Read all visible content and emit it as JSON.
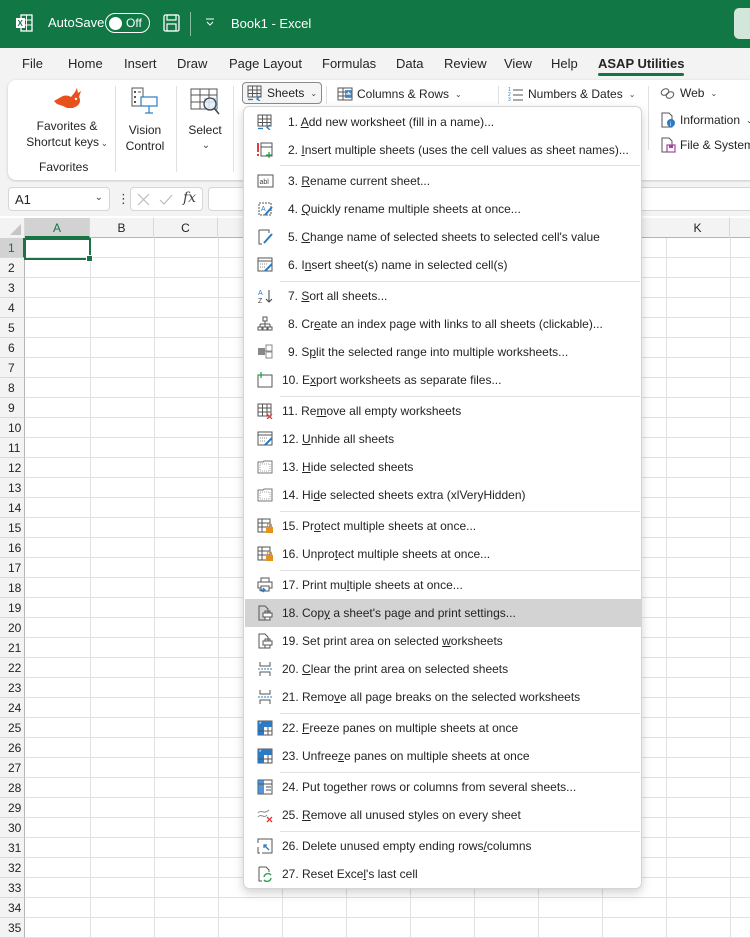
{
  "titlebar": {
    "autosave_label": "AutoSave",
    "autosave_state": "Off",
    "title": "Book1  -  Excel"
  },
  "menu_tabs": [
    {
      "label": "File"
    },
    {
      "label": "Home"
    },
    {
      "label": "Insert"
    },
    {
      "label": "Draw"
    },
    {
      "label": "Page Layout"
    },
    {
      "label": "Formulas"
    },
    {
      "label": "Data"
    },
    {
      "label": "Review"
    },
    {
      "label": "View"
    },
    {
      "label": "Help"
    },
    {
      "label": "ASAP Utilities",
      "active": true
    }
  ],
  "ribbon": {
    "favorites_line1": "Favorites &",
    "favorites_line2": "Shortcut keys",
    "favorites_group": "Favorites",
    "vision_line1": "Vision",
    "vision_line2": "Control",
    "select_label": "Select",
    "sheets_label": "Sheets",
    "columns_rows_label": "Columns & Rows",
    "numbers_dates_label": "Numbers & Dates",
    "web_label": "Web",
    "information_label": "Information",
    "file_system_label": "File & System"
  },
  "formula_bar": {
    "name_box": "A1",
    "fx_label": "fx",
    "value": ""
  },
  "grid": {
    "columns": [
      "A",
      "B",
      "C",
      "K"
    ],
    "rows": [
      "1",
      "2",
      "3",
      "4",
      "5",
      "6",
      "7",
      "8",
      "9",
      "10",
      "11",
      "12",
      "13",
      "14",
      "15",
      "16",
      "17",
      "18",
      "19",
      "20",
      "21",
      "22",
      "23",
      "24",
      "25",
      "26",
      "27",
      "28",
      "29",
      "30",
      "31",
      "32",
      "33",
      "34",
      "35"
    ],
    "active_cell": "A1"
  },
  "sheets_menu": {
    "items": [
      {
        "num": "1.",
        "pre": "",
        "u": "A",
        "post": "dd new worksheet (fill in a name)...",
        "icon": "add-worksheet-icon"
      },
      {
        "num": "2.",
        "pre": "",
        "u": "I",
        "post": "nsert multiple sheets (uses the cell values as sheet names)...",
        "icon": "insert-multiple-sheets-icon"
      },
      {
        "num": "3.",
        "pre": "",
        "u": "R",
        "post": "ename current sheet...",
        "icon": "rename-sheet-icon"
      },
      {
        "num": "4.",
        "pre": "",
        "u": "Q",
        "post": "uickly rename multiple sheets at once...",
        "icon": "quick-rename-icon"
      },
      {
        "num": "5.",
        "pre": "",
        "u": "C",
        "post": "hange name of selected sheets to selected cell's value",
        "icon": "change-name-icon"
      },
      {
        "num": "6.",
        "pre": "I",
        "u": "n",
        "post": "sert sheet(s) name in selected cell(s)",
        "icon": "insert-sheet-name-icon"
      },
      {
        "num": "7.",
        "pre": "",
        "u": "S",
        "post": "ort all sheets...",
        "icon": "sort-az-icon"
      },
      {
        "num": "8.",
        "pre": "Cr",
        "u": "e",
        "post": "ate an index page with links to all sheets (clickable)...",
        "icon": "index-tree-icon"
      },
      {
        "num": "9.",
        "pre": "S",
        "u": "p",
        "post": "lit the selected range into multiple worksheets...",
        "icon": "split-range-icon"
      },
      {
        "num": "10.",
        "pre": "E",
        "u": "x",
        "post": "port worksheets as separate files...",
        "icon": "export-sheets-icon"
      },
      {
        "num": "11.",
        "pre": "Re",
        "u": "m",
        "post": "ove all empty worksheets",
        "icon": "remove-empty-sheets-icon"
      },
      {
        "num": "12.",
        "pre": "",
        "u": "U",
        "post": "nhide all sheets",
        "icon": "unhide-sheets-icon"
      },
      {
        "num": "13.",
        "pre": "",
        "u": "H",
        "post": "ide selected sheets",
        "icon": "hide-sheets-icon"
      },
      {
        "num": "14.",
        "pre": "Hi",
        "u": "d",
        "post": "e selected sheets extra (xlVeryHidden)",
        "icon": "hide-sheets-extra-icon"
      },
      {
        "num": "15.",
        "pre": "Pr",
        "u": "o",
        "post": "tect multiple sheets at once...",
        "icon": "protect-sheets-icon"
      },
      {
        "num": "16.",
        "pre": "Unpro",
        "u": "t",
        "post": "ect multiple sheets at once...",
        "icon": "unprotect-sheets-icon"
      },
      {
        "num": "17.",
        "pre": "Print mu",
        "u": "l",
        "post": "tiple sheets at once...",
        "icon": "print-multiple-icon"
      },
      {
        "num": "18.",
        "pre": "Cop",
        "u": "y",
        "post": " a sheet's page and print settings...",
        "icon": "copy-page-settings-icon",
        "highlighted": true
      },
      {
        "num": "19.",
        "pre": "Set print area on selected ",
        "u": "w",
        "post": "orksheets",
        "icon": "set-print-area-icon"
      },
      {
        "num": "20.",
        "pre": "",
        "u": "C",
        "post": "lear the print area on selected sheets",
        "icon": "clear-print-area-icon"
      },
      {
        "num": "21.",
        "pre": "Remo",
        "u": "v",
        "post": "e all page breaks on the selected worksheets",
        "icon": "remove-page-breaks-icon"
      },
      {
        "num": "22.",
        "pre": "",
        "u": "F",
        "post": "reeze panes on multiple sheets at once",
        "icon": "freeze-panes-icon"
      },
      {
        "num": "23.",
        "pre": "Unfree",
        "u": "z",
        "post": "e panes on multiple sheets at once",
        "icon": "unfreeze-panes-icon"
      },
      {
        "num": "24.",
        "pre": "Put to",
        "u": "g",
        "post": "ether rows or columns from several sheets...",
        "icon": "combine-sheets-icon"
      },
      {
        "num": "25.",
        "pre": "",
        "u": "R",
        "post": "emove all unused styles on every sheet",
        "icon": "remove-styles-icon"
      },
      {
        "num": "26.",
        "pre": "Delete unused empty ending rows",
        "u": "/",
        "post": "columns",
        "icon": "delete-ending-icon"
      },
      {
        "num": "27.",
        "pre": "Reset Exce",
        "u": "l",
        "post": "'s last cell",
        "icon": "reset-last-cell-icon"
      }
    ]
  },
  "colors": {
    "brand_green": "#117744",
    "highlight": "#d3d3d3"
  }
}
